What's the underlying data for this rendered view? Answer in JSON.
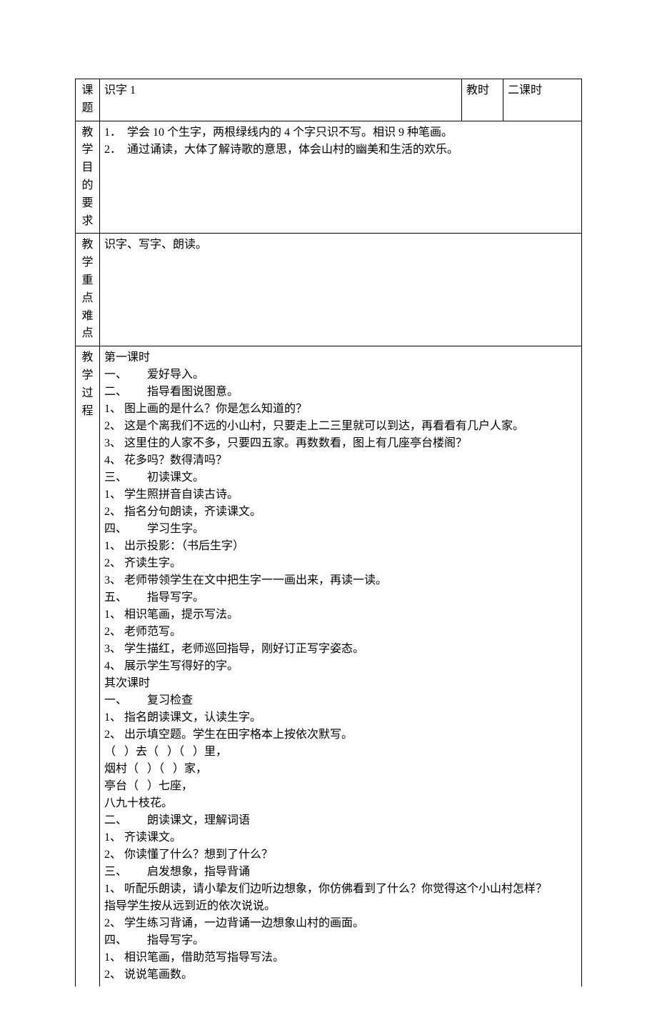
{
  "row1": {
    "label": "课题",
    "title": "识字   1",
    "time_label": "教时",
    "time_value": "二课时"
  },
  "row2": {
    "label_chars": [
      "教学",
      "目的",
      "要求"
    ],
    "lines": [
      "1．  学会 10 个生字，两根绿线内的 4 个字只识不写。相识 9 种笔画。",
      "2．  通过诵读，大体了解诗歌的意思，体会山村的幽美和生活的欢乐。"
    ]
  },
  "row3": {
    "label_chars": [
      "教学",
      "重点",
      "难点"
    ],
    "content": "识字、写字、朗读。"
  },
  "row4": {
    "label_chars": [
      "教",
      "学",
      "过",
      "程"
    ],
    "lines": [
      "第一课时",
      "一、       爱好导入。",
      "二、       指导看图说图意。",
      "1、 图上画的是什么？你是怎么知道的？",
      "2、 这是个离我们不远的小山村，只要走上二三里就可以到达，再看看有几户人家。",
      "3、 这里住的人家不多，只要四五家。再数数看，图上有几座亭台楼阁？",
      "4、 花多吗？数得清吗？",
      "三、       初读课文。",
      "1、 学生照拼音自读古诗。",
      "2、 指名分句朗读，齐读课文。",
      "四、       学习生字。",
      "1、 出示投影：（书后生字）",
      "2、 齐读生字。",
      "3、 老师带领学生在文中把生字一一画出来，再读一读。",
      "五、       指导写字。",
      "1、 相识笔画，提示写法。",
      "2、 老师范写。",
      "3、 学生描红，老师巡回指导，刚好订正写字姿态。",
      "4、 展示学生写得好的字。",
      "",
      "其次课时",
      "一、       复习检查",
      "1、 指名朗读课文，认读生字。",
      "2、 出示填空题。学生在田字格本上按依次默写。",
      "（   ）去（   ）（   ）里，",
      "烟村（   ）（   ）家，",
      "亭台（   ）七座，",
      "八九十枝花。",
      "二、       朗读课文，理解词语",
      "1、 齐读课文。",
      "2、 你读懂了什么？想到了什么？",
      "三、       启发想象，指导背诵",
      "1、 听配乐朗读，请小挚友们边听边想象，你仿佛看到了什么？你觉得这个小山村怎样？",
      "指导学生按从远到近的依次说说。",
      "2、 学生练习背诵，一边背诵一边想象山村的画面。",
      "四、       指导写字。",
      "1、 相识笔画，借助范写指导写法。",
      "2、 说说笔画数。"
    ]
  }
}
